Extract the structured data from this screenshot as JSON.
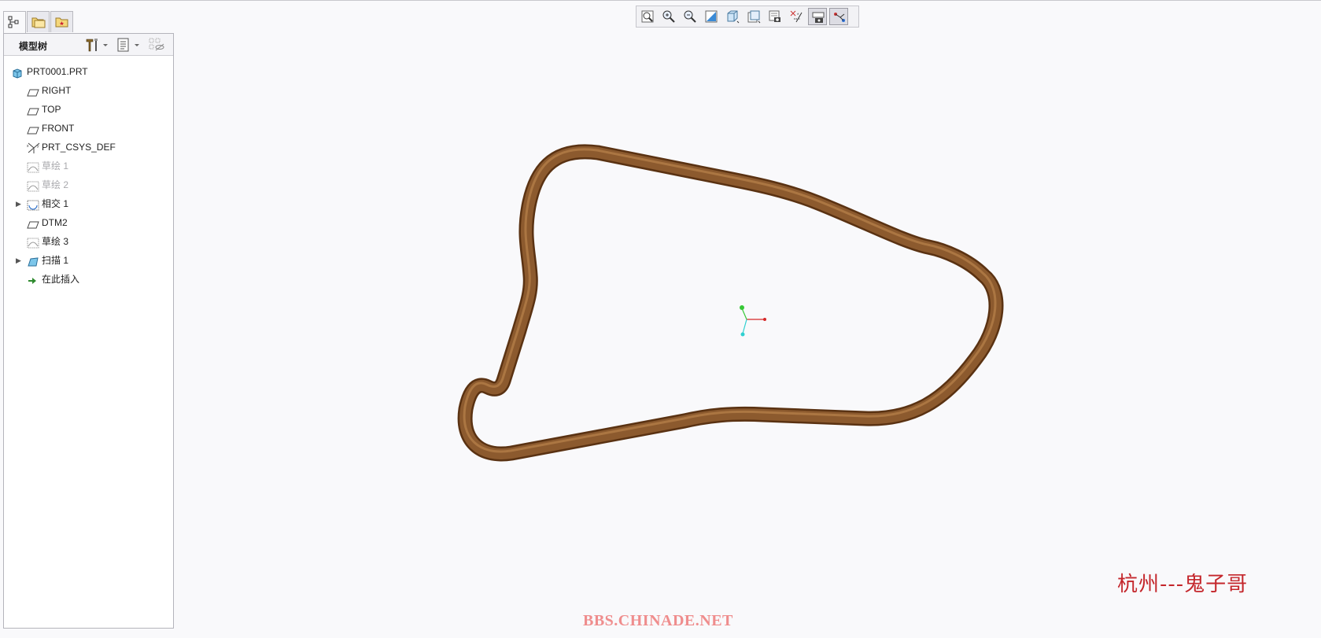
{
  "panel": {
    "title": "模型树",
    "tabs": [
      {
        "icon": "model-tree-icon"
      },
      {
        "icon": "folder-browser-icon"
      },
      {
        "icon": "favorites-icon"
      }
    ]
  },
  "tree": {
    "items": [
      {
        "label": "PRT0001.PRT",
        "icon": "part-icon",
        "level": 0
      },
      {
        "label": "RIGHT",
        "icon": "datum-plane-icon",
        "level": 1
      },
      {
        "label": "TOP",
        "icon": "datum-plane-icon",
        "level": 1
      },
      {
        "label": "FRONT",
        "icon": "datum-plane-icon",
        "level": 1
      },
      {
        "label": "PRT_CSYS_DEF",
        "icon": "csys-icon",
        "level": 1
      },
      {
        "label": "草绘 1",
        "icon": "sketch-icon",
        "level": 1,
        "disabled": true
      },
      {
        "label": "草绘 2",
        "icon": "sketch-icon",
        "level": 1,
        "disabled": true
      },
      {
        "label": "相交 1",
        "icon": "intersect-icon",
        "level": 1,
        "expandable": true
      },
      {
        "label": "DTM2",
        "icon": "datum-plane-icon",
        "level": 1
      },
      {
        "label": "草绘 3",
        "icon": "sketch-icon",
        "level": 1
      },
      {
        "label": "扫描 1",
        "icon": "sweep-icon",
        "level": 1,
        "expandable": true
      },
      {
        "label": "在此插入",
        "icon": "insert-here-icon",
        "level": 1
      }
    ]
  },
  "toolbar": {
    "buttons": [
      {
        "icon": "refit-icon"
      },
      {
        "icon": "zoom-in-icon"
      },
      {
        "icon": "zoom-out-icon"
      },
      {
        "icon": "repaint-icon"
      },
      {
        "icon": "display-style-icon"
      },
      {
        "icon": "saved-orientations-icon"
      },
      {
        "icon": "view-manager-icon"
      },
      {
        "icon": "datum-display-icon"
      },
      {
        "icon": "annotation-display-icon",
        "active": true
      },
      {
        "icon": "spin-center-icon",
        "active": true
      }
    ]
  },
  "watermark": {
    "author": "杭州---鬼子哥",
    "site": "BBS.CHINADE.NET"
  },
  "colors": {
    "tube": "#7a4a22",
    "axis_x": "#d62828",
    "axis_y": "#37c837",
    "axis_z": "#2fd0d0"
  }
}
